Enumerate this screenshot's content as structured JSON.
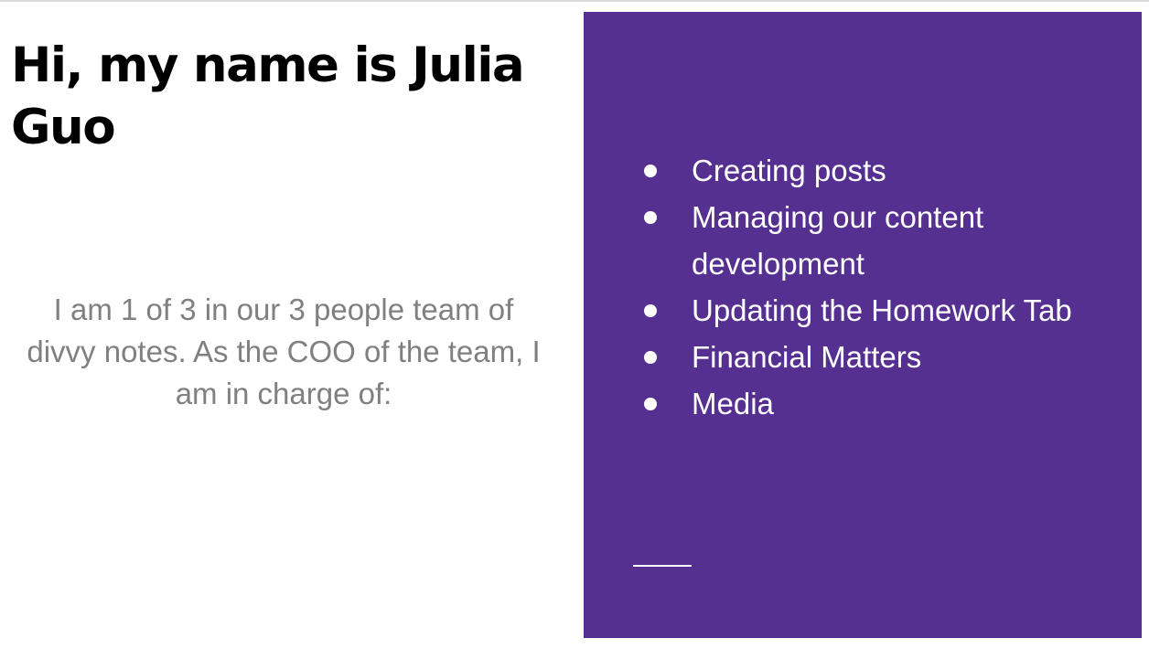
{
  "slide": {
    "title": "Hi, my name is Julia Guo",
    "intro": "I am 1 of 3 in our 3 people team of divvy notes. As the COO of the team, I am in charge of:",
    "panel": {
      "background_color": "#553090",
      "items": [
        {
          "label": "Creating posts"
        },
        {
          "label": "Managing our content development"
        },
        {
          "label": "Updating the Homework Tab"
        },
        {
          "label": "Financial Matters"
        },
        {
          "label": "Media"
        }
      ]
    }
  }
}
